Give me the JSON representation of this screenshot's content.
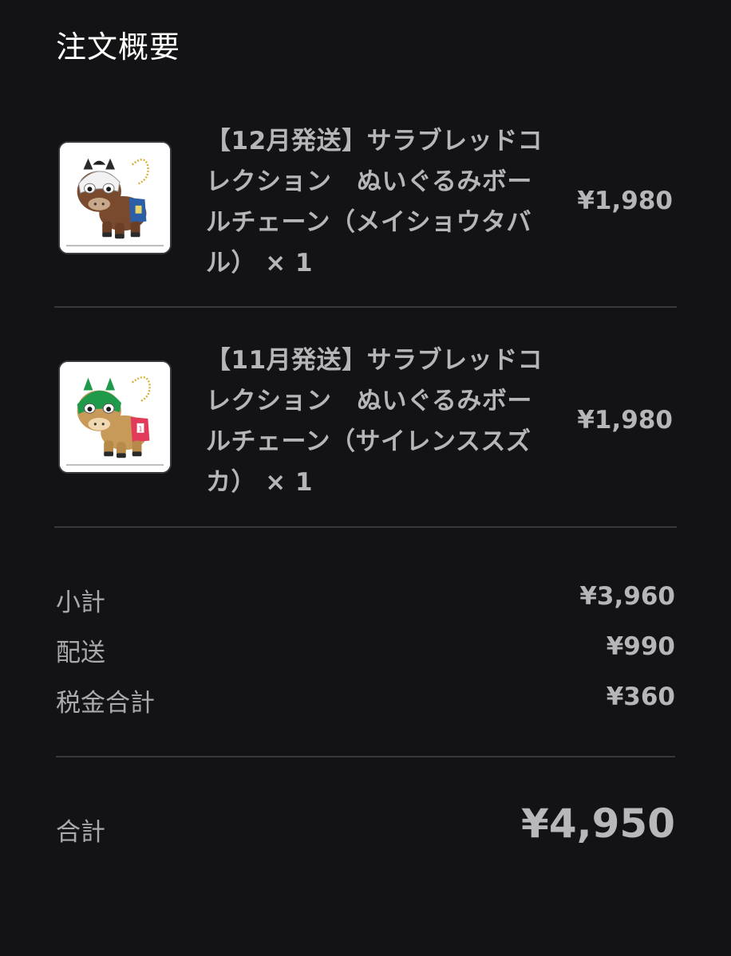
{
  "header": {
    "title": "注文概要"
  },
  "items": [
    {
      "title": "【12月発送】サラブレッドコレクション　ぬいぐるみボールチェーン（メイショウタバル） × 1",
      "price": "¥1,980",
      "thumbnail_icon": "plush-horse-brown-icon",
      "colors": {
        "body": "#7a4a2e",
        "mask": "#f2f2f2",
        "pad": "#2b5fa8"
      }
    },
    {
      "title": "【11月発送】サラブレッドコレクション　ぬいぐるみボールチェーン（サイレンススズカ） × 1",
      "price": "¥1,980",
      "thumbnail_icon": "plush-horse-tan-icon",
      "colors": {
        "body": "#c89a5a",
        "mask": "#1e9a4a",
        "pad": "#e23b5a"
      }
    }
  ],
  "summary": {
    "subtotal_label": "小計",
    "subtotal_value": "¥3,960",
    "shipping_label": "配送",
    "shipping_value": "¥990",
    "tax_label": "税金合計",
    "tax_value": "¥360"
  },
  "total": {
    "label": "合計",
    "value": "¥4,950"
  },
  "theme": {
    "background": "#131315",
    "divider": "#38383c",
    "title_text": "#ffffff",
    "body_text": "#b6b6ba"
  }
}
